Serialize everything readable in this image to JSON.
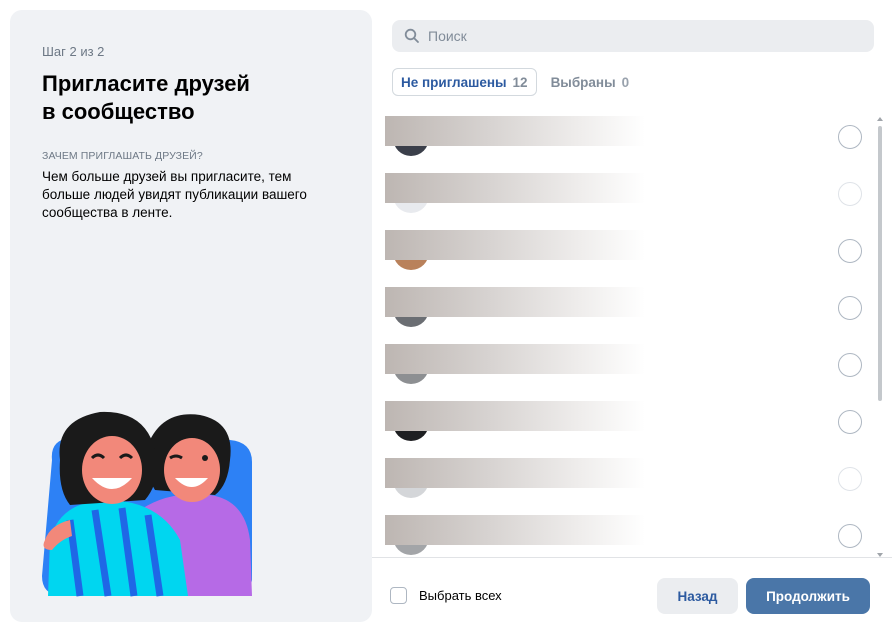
{
  "left": {
    "step": "Шаг 2 из 2",
    "title_line1": "Пригласите друзей",
    "title_line2": "в сообщество",
    "why_caption": "ЗАЧЕМ ПРИГЛАШАТЬ ДРУЗЕЙ?",
    "why_text": "Чем больше друзей вы пригласите, тем больше людей увидят публикации вашего сообщества в ленте."
  },
  "search": {
    "placeholder": "Поиск",
    "value": ""
  },
  "tabs": [
    {
      "label": "Не приглашены",
      "count": "12",
      "active": true
    },
    {
      "label": "Выбраны",
      "count": "0",
      "active": false
    }
  ],
  "friends": [
    {
      "avatar_color": "#3b3f4a",
      "faint": false
    },
    {
      "avatar_color": "#e8eaee",
      "faint": true
    },
    {
      "avatar_color": "#b9815b",
      "faint": false
    },
    {
      "avatar_color": "#6b6e73",
      "faint": false
    },
    {
      "avatar_color": "#8d8f92",
      "faint": false
    },
    {
      "avatar_color": "#1e1f22",
      "faint": false
    },
    {
      "avatar_color": "#d4d6d9",
      "faint": true
    },
    {
      "avatar_color": "#a3a5a8",
      "faint": false
    }
  ],
  "footer": {
    "select_all": "Выбрать всех",
    "back": "Назад",
    "continue": "Продолжить"
  },
  "colors": {
    "accent": "#4a76a8",
    "accent_text": "#2c5aa0",
    "panel_bg": "#f0f2f5"
  }
}
